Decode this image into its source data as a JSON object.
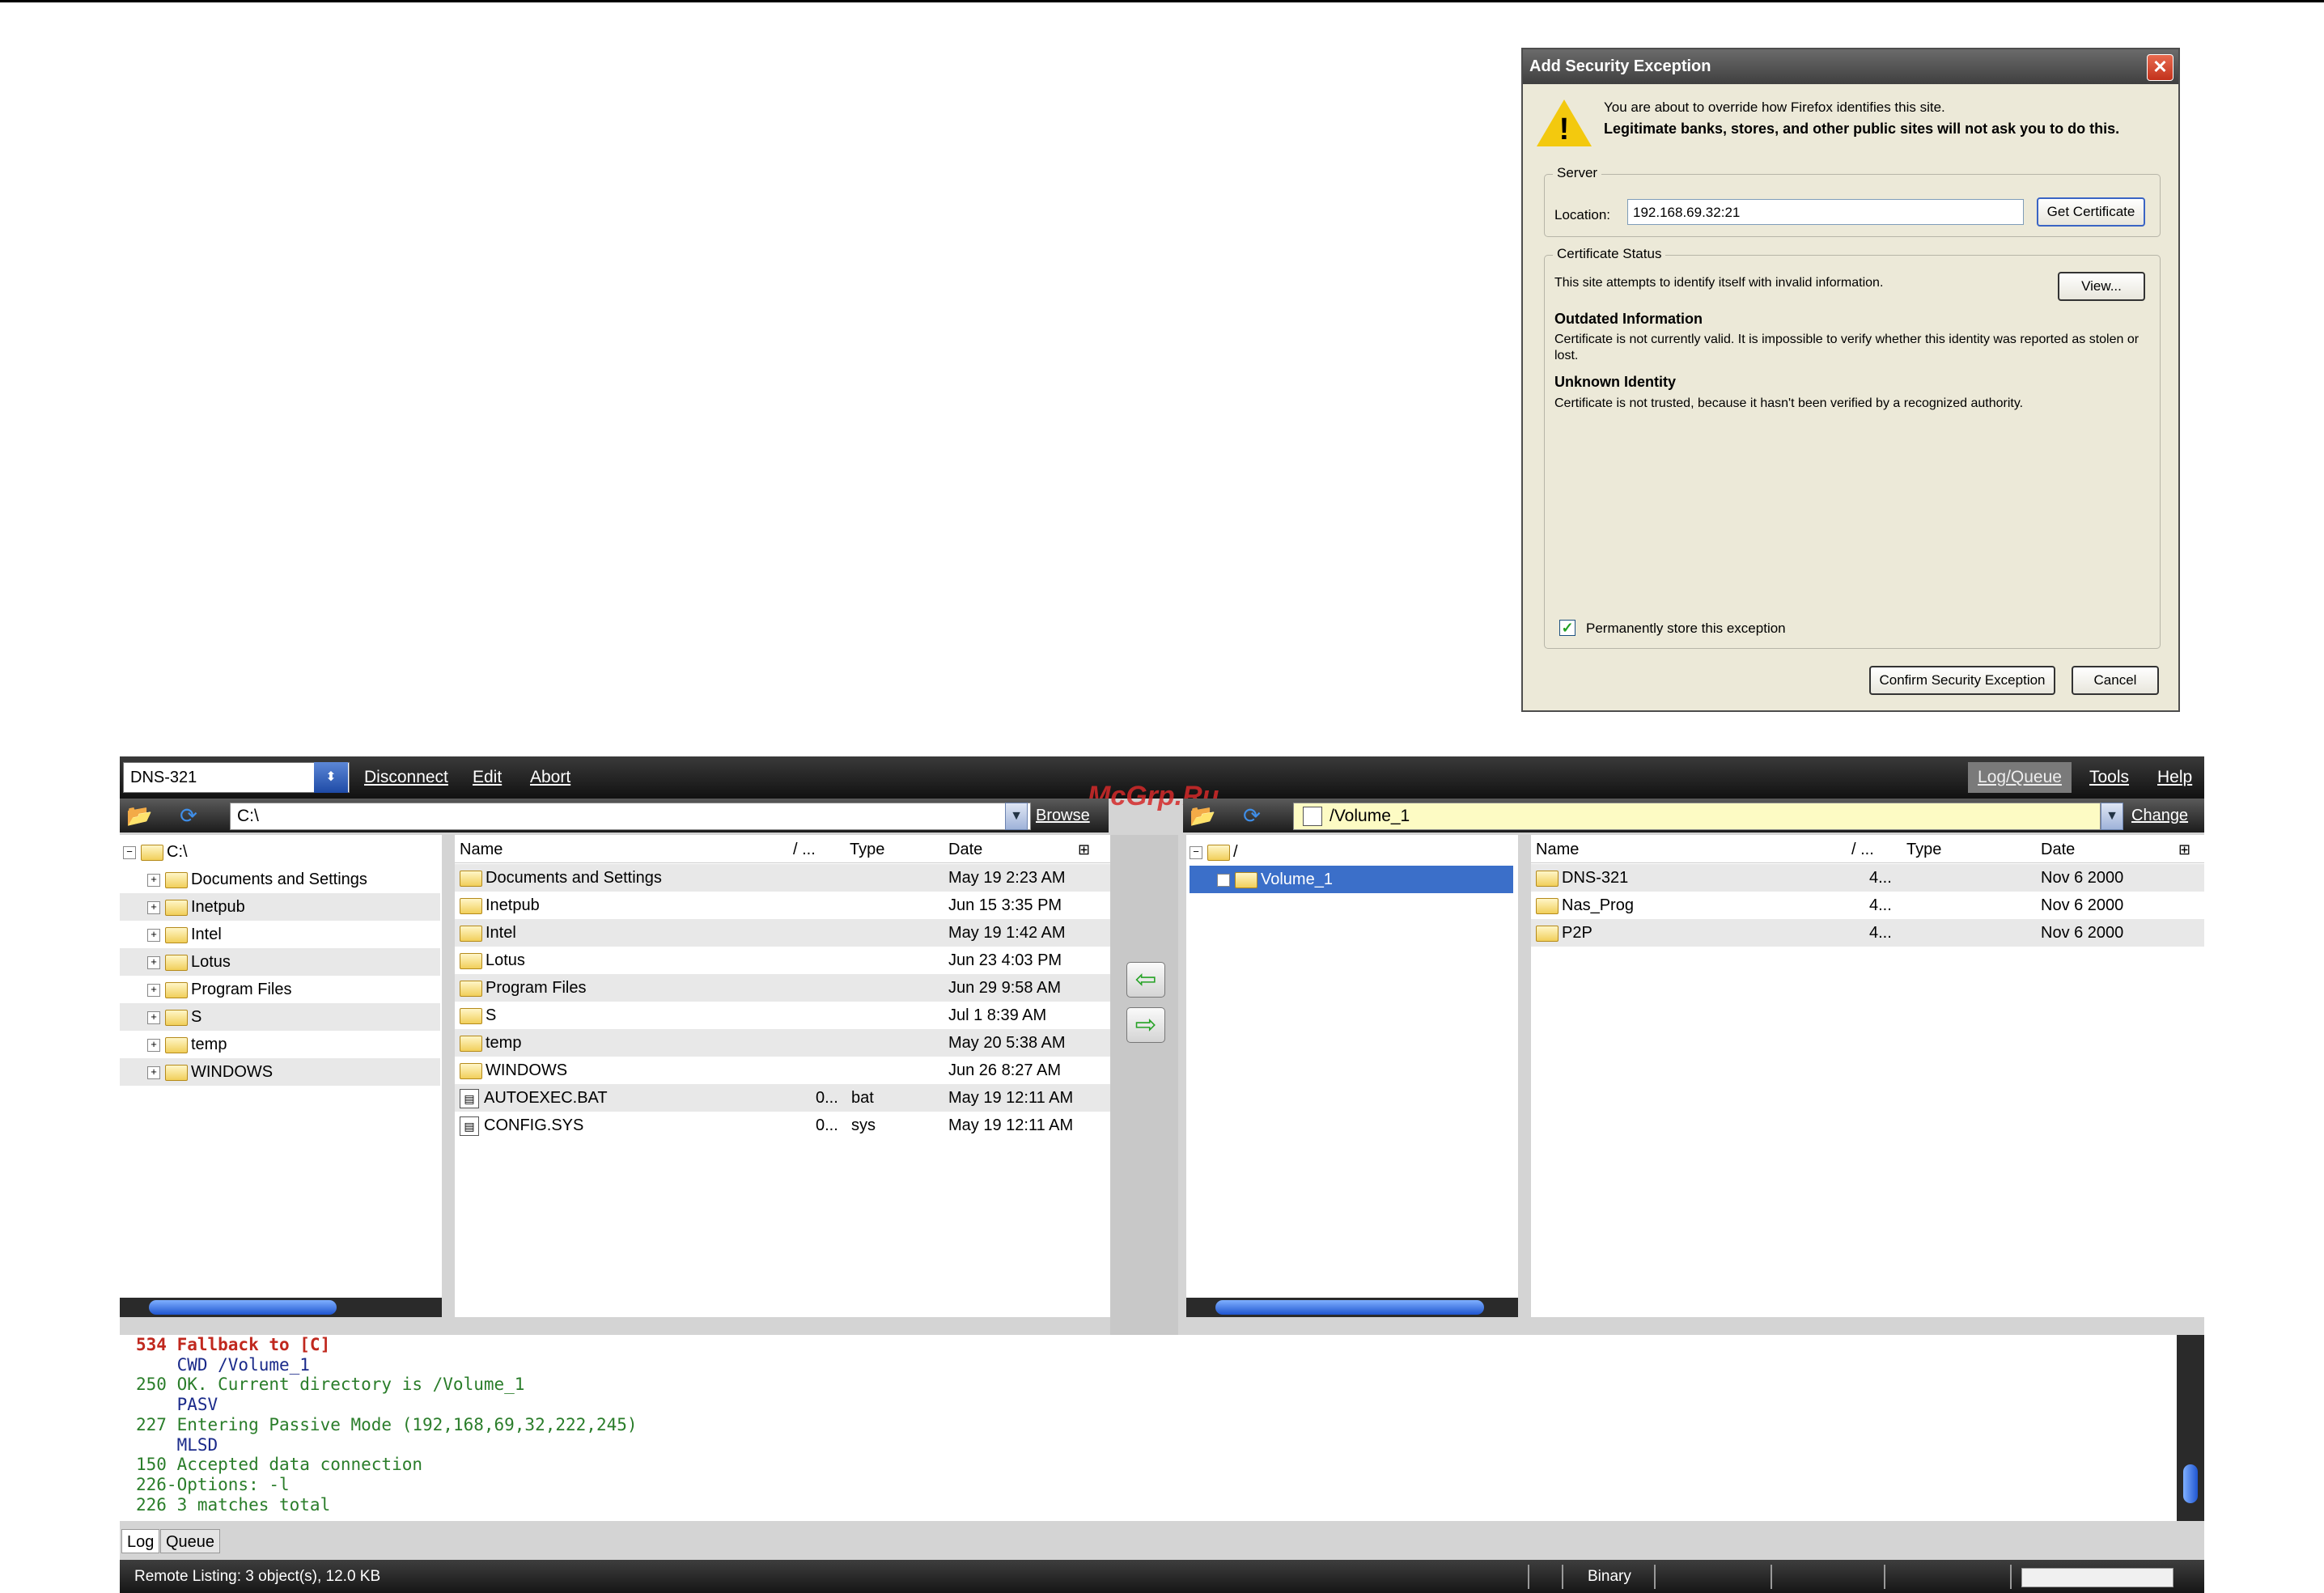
{
  "dialog": {
    "title": "Add Security Exception",
    "intro": "You are about to override how Firefox identifies this site.",
    "warning": "Legitimate banks, stores, and other public sites will not ask you to do this.",
    "server_label": "Server",
    "location_label": "Location:",
    "location_value": "192.168.69.32:21",
    "get_certificate": "Get Certificate",
    "status_label": "Certificate Status",
    "status_text": "This site attempts to identify itself with invalid information.",
    "view_button": "View...",
    "outdated_head": "Outdated Information",
    "outdated_text": "Certificate is not currently valid. It is impossible to verify whether this identity was reported as stolen or lost.",
    "unknown_head": "Unknown Identity",
    "unknown_text": "Certificate is not trusted, because it hasn't been verified by a recognized authority.",
    "permanent_label": "Permanently store this exception",
    "confirm_button": "Confirm Security Exception",
    "cancel_button": "Cancel"
  },
  "app": {
    "site": "DNS-321",
    "menu": {
      "disconnect": "Disconnect",
      "edit": "Edit",
      "abort": "Abort",
      "log_queue": "Log/Queue",
      "tools": "Tools",
      "help": "Help"
    },
    "watermark": "McGrp.Ru",
    "local": {
      "path": "C:\\",
      "browse": "Browse",
      "root": "C:\\",
      "tree": [
        "Documents and Settings",
        "Inetpub",
        "Intel",
        "Lotus",
        "Program Files",
        "S",
        "temp",
        "WINDOWS"
      ],
      "headers": {
        "name": "Name",
        "size": "/ ...",
        "type": "Type",
        "date": "Date"
      },
      "files": [
        {
          "name": "Documents and Settings",
          "size": "",
          "type": "",
          "date": "May 19 2:23 AM"
        },
        {
          "name": "Inetpub",
          "size": "",
          "type": "",
          "date": "Jun 15 3:35 PM"
        },
        {
          "name": "Intel",
          "size": "",
          "type": "",
          "date": "May 19 1:42 AM"
        },
        {
          "name": "Lotus",
          "size": "",
          "type": "",
          "date": "Jun 23 4:03 PM"
        },
        {
          "name": "Program Files",
          "size": "",
          "type": "",
          "date": "Jun 29 9:58 AM"
        },
        {
          "name": "S",
          "size": "",
          "type": "",
          "date": "Jul 1 8:39 AM"
        },
        {
          "name": "temp",
          "size": "",
          "type": "",
          "date": "May 20 5:38 AM"
        },
        {
          "name": "WINDOWS",
          "size": "",
          "type": "",
          "date": "Jun 26 8:27 AM"
        },
        {
          "name": "AUTOEXEC.BAT",
          "size": "0...",
          "type": "bat",
          "date": "May 19 12:11 AM"
        },
        {
          "name": "CONFIG.SYS",
          "size": "0...",
          "type": "sys",
          "date": "May 19 12:11 AM"
        }
      ]
    },
    "remote": {
      "path": "/Volume_1",
      "change": "Change",
      "root": "/",
      "tree": [
        "Volume_1"
      ],
      "headers": {
        "name": "Name",
        "size": "/ ...",
        "type": "Type",
        "date": "Date"
      },
      "files": [
        {
          "name": "DNS-321",
          "size": "4...",
          "date": "Nov 6 2000"
        },
        {
          "name": "Nas_Prog",
          "size": "4...",
          "date": "Nov 6 2000"
        },
        {
          "name": "P2P",
          "size": "4...",
          "date": "Nov 6 2000"
        }
      ]
    },
    "log": [
      {
        "text": "534 Fallback to [C]",
        "kind": "error"
      },
      {
        "text": "    CWD /Volume_1",
        "kind": "cmd"
      },
      {
        "text": "250 OK. Current directory is /Volume_1",
        "kind": "resp"
      },
      {
        "text": "    PASV",
        "kind": "cmd"
      },
      {
        "text": "227 Entering Passive Mode (192,168,69,32,222,245)",
        "kind": "resp"
      },
      {
        "text": "    MLSD",
        "kind": "cmd"
      },
      {
        "text": "150 Accepted data connection",
        "kind": "resp"
      },
      {
        "text": "226-Options: -l",
        "kind": "resp"
      },
      {
        "text": "226 3 matches total",
        "kind": "resp"
      }
    ],
    "tabs": {
      "log": "Log",
      "queue": "Queue"
    },
    "status": {
      "listing": "Remote Listing: 3 object(s), 12.0 KB",
      "mode": "Binary"
    },
    "colors": {
      "error": "#c0281e",
      "cmd": "#1a2a8a",
      "resp": "#2a7d2a",
      "selection": "#3b6fc9"
    }
  }
}
